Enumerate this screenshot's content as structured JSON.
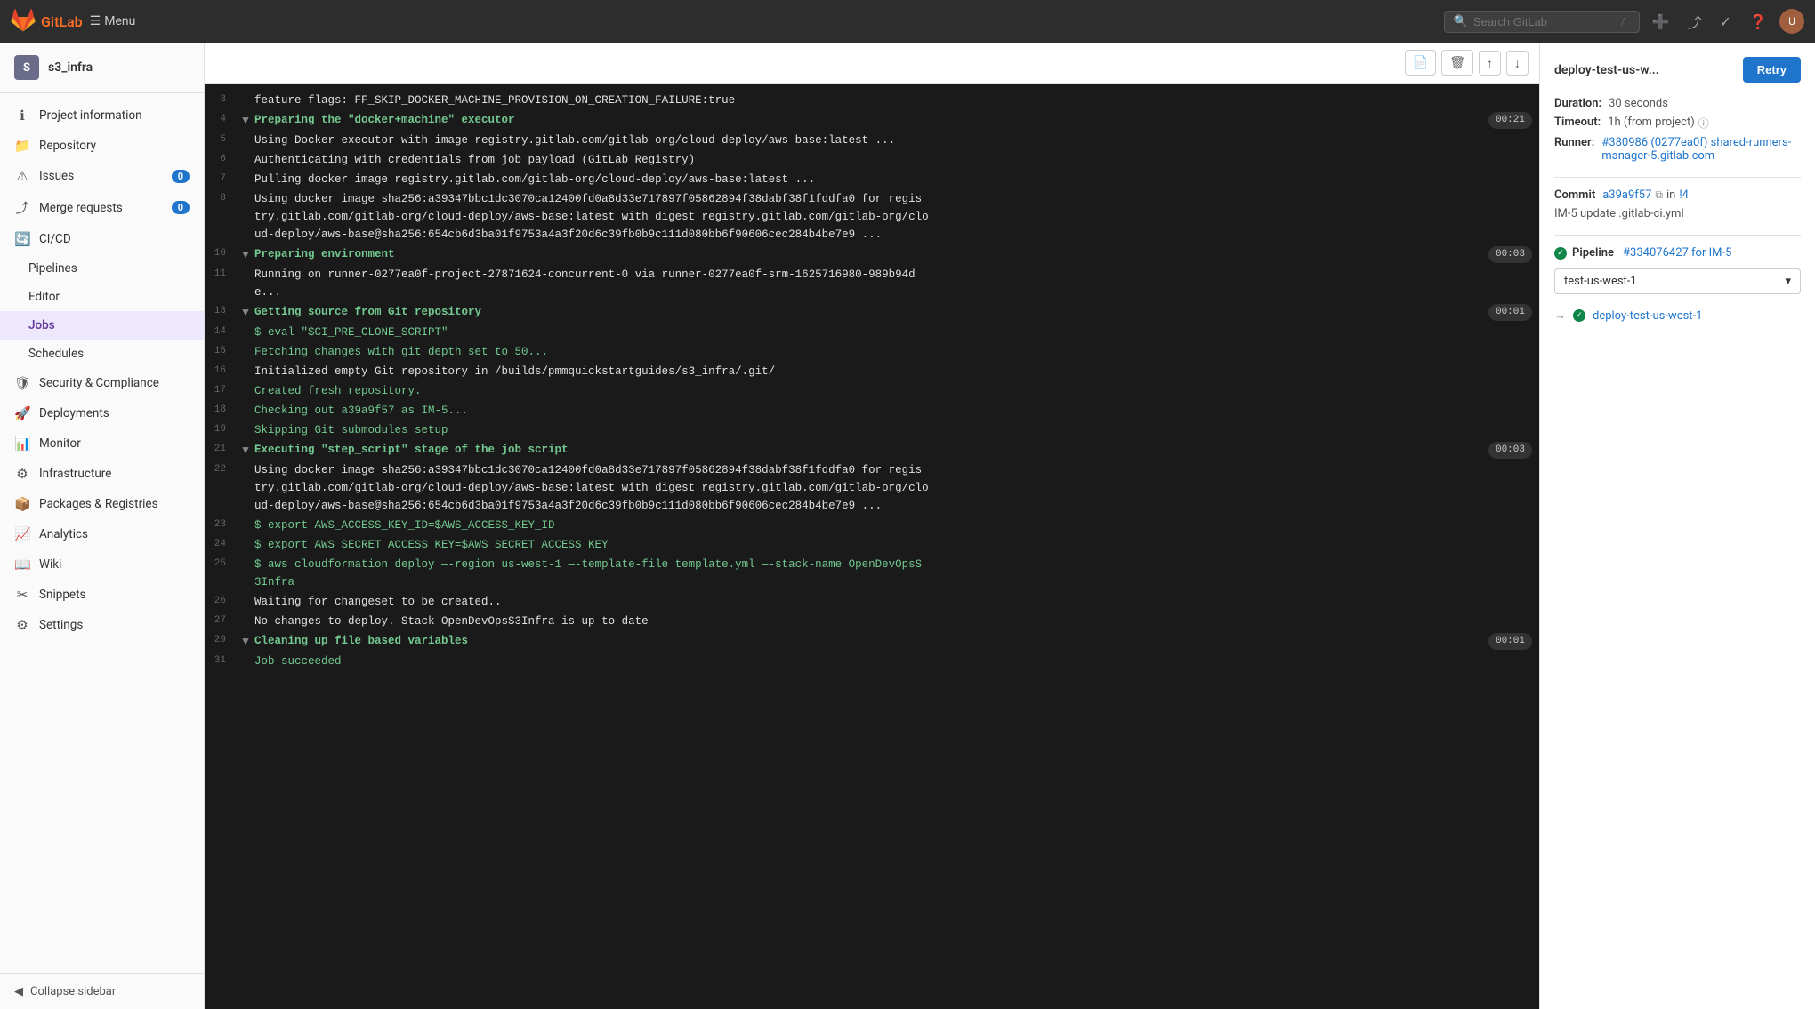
{
  "navbar": {
    "logo_text": "GitLab",
    "menu_label": "Menu",
    "search_placeholder": "Search GitLab",
    "icons": [
      "plus-icon",
      "merge-request-icon",
      "todo-icon",
      "help-icon",
      "user-icon"
    ]
  },
  "sidebar": {
    "project_initial": "S",
    "project_name": "s3_infra",
    "items": [
      {
        "id": "project-information",
        "label": "Project information",
        "icon": "ℹ️",
        "badge": null,
        "active": false
      },
      {
        "id": "repository",
        "label": "Repository",
        "icon": "📁",
        "badge": null,
        "active": false
      },
      {
        "id": "issues",
        "label": "Issues",
        "icon": "⚠️",
        "badge": "0",
        "active": false
      },
      {
        "id": "merge-requests",
        "label": "Merge requests",
        "icon": "⤴",
        "badge": "0",
        "active": false
      },
      {
        "id": "cicd",
        "label": "CI/CD",
        "icon": "🔄",
        "badge": null,
        "active": false
      },
      {
        "id": "pipelines",
        "label": "Pipelines",
        "icon": "",
        "badge": null,
        "active": false,
        "sub": true
      },
      {
        "id": "editor",
        "label": "Editor",
        "icon": "",
        "badge": null,
        "active": false,
        "sub": true
      },
      {
        "id": "jobs",
        "label": "Jobs",
        "icon": "",
        "badge": null,
        "active": true,
        "sub": true
      },
      {
        "id": "schedules",
        "label": "Schedules",
        "icon": "",
        "badge": null,
        "active": false,
        "sub": true
      },
      {
        "id": "security-compliance",
        "label": "Security & Compliance",
        "icon": "🛡",
        "badge": null,
        "active": false
      },
      {
        "id": "deployments",
        "label": "Deployments",
        "icon": "🚀",
        "badge": null,
        "active": false
      },
      {
        "id": "monitor",
        "label": "Monitor",
        "icon": "📊",
        "badge": null,
        "active": false
      },
      {
        "id": "infrastructure",
        "label": "Infrastructure",
        "icon": "⚙",
        "badge": null,
        "active": false
      },
      {
        "id": "packages-registries",
        "label": "Packages & Registries",
        "icon": "📦",
        "badge": null,
        "active": false
      },
      {
        "id": "analytics",
        "label": "Analytics",
        "icon": "📈",
        "badge": null,
        "active": false
      },
      {
        "id": "wiki",
        "label": "Wiki",
        "icon": "📖",
        "badge": null,
        "active": false
      },
      {
        "id": "snippets",
        "label": "Snippets",
        "icon": "✂",
        "badge": null,
        "active": false
      },
      {
        "id": "settings",
        "label": "Settings",
        "icon": "⚙",
        "badge": null,
        "active": false
      }
    ],
    "collapse_label": "Collapse sidebar"
  },
  "job_log": {
    "lines": [
      {
        "num": "3",
        "toggle": null,
        "text": "feature flags: FF_SKIP_DOCKER_MACHINE_PROVISION_ON_CREATION_FAILURE:true",
        "color": "white",
        "timestamp": null
      },
      {
        "num": "4",
        "toggle": "▼",
        "text": "Preparing the \"docker+machine\" executor",
        "color": "green",
        "timestamp": "00:21"
      },
      {
        "num": "5",
        "toggle": null,
        "text": "Using Docker executor with image registry.gitlab.com/gitlab-org/cloud-deploy/aws-base:latest ...",
        "color": "white",
        "timestamp": null
      },
      {
        "num": "6",
        "toggle": null,
        "text": "Authenticating with credentials from job payload (GitLab Registry)",
        "color": "white",
        "timestamp": null
      },
      {
        "num": "7",
        "toggle": null,
        "text": "Pulling docker image registry.gitlab.com/gitlab-org/cloud-deploy/aws-base:latest ...",
        "color": "white",
        "timestamp": null
      },
      {
        "num": "8",
        "toggle": null,
        "text": "Using docker image sha256:a39347bbc1dc3070ca12400fd0a8d33e717897f05862894f38dabf38f1fddfa0 for registry.gitlab.com/gitlab-org/cloud-deploy/aws-base:latest with digest registry.gitlab.com/gitlab-org/cloud-deploy/aws-base@sha256:654cb6d3ba01f9753a4a3f20d6c39fb0b9c111d080bb6f90606cec284b4be7e9 ...",
        "color": "white",
        "timestamp": null
      },
      {
        "num": "10",
        "toggle": "▼",
        "text": "Preparing environment",
        "color": "green",
        "timestamp": "00:03"
      },
      {
        "num": "11",
        "toggle": null,
        "text": "Running on runner-0277ea0f-project-27871624-concurrent-0 via runner-0277ea0f-srm-1625716980-989b94de...",
        "color": "white",
        "timestamp": null
      },
      {
        "num": "13",
        "toggle": "▼",
        "text": "Getting source from Git repository",
        "color": "green",
        "timestamp": "00:01"
      },
      {
        "num": "14",
        "toggle": null,
        "text": "$ eval \"$CI_PRE_CLONE_SCRIPT\"",
        "color": "green",
        "timestamp": null
      },
      {
        "num": "15",
        "toggle": null,
        "text": "Fetching changes with git depth set to 50...",
        "color": "green",
        "timestamp": null
      },
      {
        "num": "16",
        "toggle": null,
        "text": "Initialized empty Git repository in /builds/pmmquickstartguides/s3_infra/.git/",
        "color": "white",
        "timestamp": null
      },
      {
        "num": "17",
        "toggle": null,
        "text": "Created fresh repository.",
        "color": "green",
        "timestamp": null
      },
      {
        "num": "18",
        "toggle": null,
        "text": "Checking out a39a9f57 as IM-5...",
        "color": "green",
        "timestamp": null
      },
      {
        "num": "19",
        "toggle": null,
        "text": "Skipping Git submodules setup",
        "color": "green",
        "timestamp": null
      },
      {
        "num": "21",
        "toggle": "▼",
        "text": "Executing \"step_script\" stage of the job script",
        "color": "green",
        "timestamp": "00:03"
      },
      {
        "num": "22",
        "toggle": null,
        "text": "Using docker image sha256:a39347bbc1dc3070ca12400fd0a8d33e717897f05862894f38dabf38f1fddfa0 for registry.gitlab.com/gitlab-org/cloud-deploy/aws-base:latest with digest registry.gitlab.com/gitlab-org/cloud-deploy/aws-base@sha256:654cb6d3ba01f9753a4a3f20d6c39fb0b9c111d080bb6f90606cec284b4be7e9 ...",
        "color": "white",
        "timestamp": null
      },
      {
        "num": "23",
        "toggle": null,
        "text": "$ export AWS_ACCESS_KEY_ID=$AWS_ACCESS_KEY_ID",
        "color": "green",
        "timestamp": null
      },
      {
        "num": "24",
        "toggle": null,
        "text": "$ export AWS_SECRET_ACCESS_KEY=$AWS_SECRET_ACCESS_KEY",
        "color": "green",
        "timestamp": null
      },
      {
        "num": "25",
        "toggle": null,
        "text": "$ aws cloudformation deploy --region us-west-1 --template-file template.yml --stack-name OpenDevOpsS3Infra",
        "color": "green",
        "timestamp": null
      },
      {
        "num": "26",
        "toggle": null,
        "text": "Waiting for changeset to be created..",
        "color": "white",
        "timestamp": null
      },
      {
        "num": "27",
        "toggle": null,
        "text": "No changes to deploy. Stack OpenDevOpsS3Infra is up to date",
        "color": "white",
        "timestamp": null
      },
      {
        "num": "29",
        "toggle": "▼",
        "text": "Cleaning up file based variables",
        "color": "green",
        "timestamp": "00:01"
      },
      {
        "num": "31",
        "toggle": null,
        "text": "Job succeeded",
        "color": "green",
        "timestamp": null
      }
    ]
  },
  "right_panel": {
    "job_title": "deploy-test-us-w...",
    "retry_label": "Retry",
    "duration_label": "Duration:",
    "duration_value": "30 seconds",
    "timeout_label": "Timeout:",
    "timeout_value": "1h (from project)",
    "runner_label": "Runner:",
    "runner_value": "#380986 (0277ea0f) shared-runners-manager-5.gitlab.com",
    "commit_label": "Commit",
    "commit_hash": "a39a9f57",
    "commit_branch_prefix": "in",
    "commit_branch": "!4",
    "commit_message": "IM-5 update .gitlab-ci.yml",
    "pipeline_label": "Pipeline",
    "pipeline_value": "#334076427 for IM-5",
    "dropdown_value": "test-us-west-1",
    "current_job_arrow": "→",
    "current_job_name": "deploy-test-us-west-1"
  }
}
